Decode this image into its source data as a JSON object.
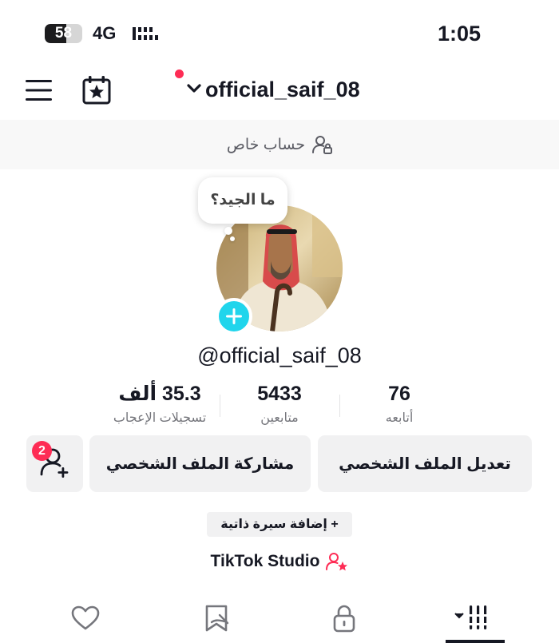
{
  "status_bar": {
    "battery_level": "58",
    "battery_fraction": 0.58,
    "network": "4G",
    "time": "1:05"
  },
  "header": {
    "username": "official_saif_08",
    "has_notification": true,
    "notification_color": "#fe2c55"
  },
  "private_banner": {
    "label": "حساب خاص"
  },
  "profile": {
    "bubble_text": "ما الجيد؟",
    "handle": "@official_saif_08"
  },
  "stats": {
    "following": {
      "value": "76",
      "label": "أتابعه"
    },
    "followers": {
      "value": "5433",
      "label": "متابعين"
    },
    "likes": {
      "value": "35.3 ألف",
      "label": "تسجيلات الإعجاب"
    }
  },
  "actions": {
    "edit_profile": "تعديل الملف الشخصي",
    "share_profile": "مشاركة الملف الشخصي",
    "friends_badge": "2"
  },
  "bio": {
    "add_bio": "+ إضافة سيرة ذاتية"
  },
  "studio": {
    "label": "TikTok Studio"
  },
  "tabs": {
    "items": [
      "videos-grid-icon",
      "lock-icon",
      "reposts-icon",
      "liked-icon"
    ],
    "selected": "videos-grid-icon"
  },
  "colors": {
    "accent": "#fe2c55",
    "add_button": "#20d5ec"
  }
}
